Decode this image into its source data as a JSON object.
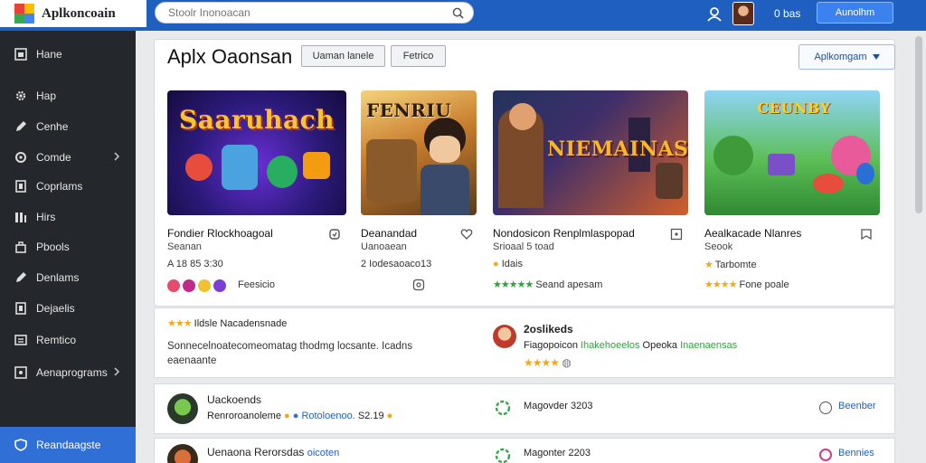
{
  "app": {
    "logo_text": "Aplkoncoain"
  },
  "search": {
    "placeholder": "Stoolr Inonoacan"
  },
  "topbar": {
    "user_text": "0 bas",
    "cta_label": "Aunolhm"
  },
  "sidebar": {
    "items": [
      {
        "label": "Hane",
        "icon": "home-icon"
      },
      {
        "label": "Hap",
        "icon": "gear-icon"
      },
      {
        "label": "Cenhe",
        "icon": "pencil-icon"
      },
      {
        "label": "Comde",
        "icon": "circle-icon"
      },
      {
        "label": "Coprlams",
        "icon": "doc-icon"
      },
      {
        "label": "Hirs",
        "icon": "bars-icon"
      },
      {
        "label": "Pbools",
        "icon": "bag-icon"
      },
      {
        "label": "Denlams",
        "icon": "pencil-icon"
      },
      {
        "label": "Dejaelis",
        "icon": "doc-icon"
      },
      {
        "label": "Remtico",
        "icon": "list-icon"
      },
      {
        "label": "Aenaprograms",
        "icon": "gear-icon"
      },
      {
        "label": "Reandaagste",
        "icon": "shield-icon"
      }
    ]
  },
  "main": {
    "title": "Aplx Oaonsan",
    "chip1": "Uaman lanele",
    "chip2": "Fetrico",
    "dropdown": "Aplkomgam"
  },
  "games": [
    {
      "banner": "Saaruhach",
      "name": "Fondier Rlockhoagoal",
      "sub": "Seanan",
      "meta": "A 18 85 3:30",
      "extra": "Feesicio"
    },
    {
      "banner": "FENRIU",
      "name": "Deanandad",
      "sub": "Uanoaean",
      "meta": "2 Iodesaoaco13",
      "extra": ""
    },
    {
      "banner": "NIEMAINAS",
      "name": "Nondosicon Renplmlaspopad",
      "sub": "Srioaal 5 toad",
      "meta": "Idais",
      "extra": "Seand apesam"
    },
    {
      "banner": "CEUNBY",
      "name": "Aealkacade Nlanres",
      "sub": "Seook",
      "meta": "Tarbomte",
      "extra": "Fone poale"
    }
  ],
  "review": {
    "stars_text": "Ildsle Nacadensnade",
    "body": "Sonnecelnoatecomeomatag thodmg locsante.  Icadns",
    "body2": "eaenaante",
    "right_title": "2oslikeds",
    "right_line1": "Fiagopoicon",
    "right_link": "Ihakehoeelos",
    "right_line2": "Opeoka",
    "right_link2": "Inaenaensas"
  },
  "list": [
    {
      "title": "Uackoends",
      "sub": "Renroroanoleme",
      "link": "Rotoloenoo.",
      "price": "S2.19",
      "date": "Magovder 3203",
      "action": "Beenber"
    },
    {
      "title": "Uenaona Rerorsdas",
      "sub": "",
      "link": "oicoten",
      "price": "",
      "date": "Magonter 2203",
      "action": "Bennies"
    }
  ]
}
